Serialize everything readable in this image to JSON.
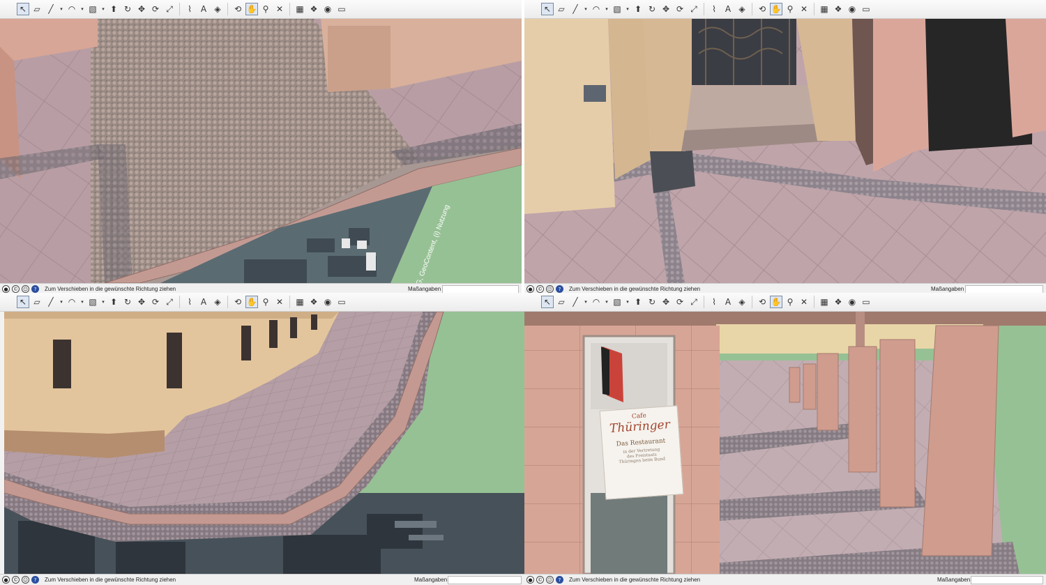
{
  "toolbar": {
    "icons": [
      "select-icon",
      "eraser-icon",
      "line-icon",
      "arc-icon",
      "shape-icon",
      "push-pull-icon",
      "follow-me-icon",
      "move-icon",
      "rotate-icon",
      "scale-icon",
      "tape-measure-icon",
      "text-icon",
      "paint-bucket-icon",
      "orbit-icon",
      "pan-icon",
      "zoom-icon",
      "zoom-extents-icon",
      "3d-warehouse-icon",
      "components-icon",
      "extension-icon",
      "layout-icon"
    ],
    "glyphs": {
      "select": "↖",
      "eraser": "▱",
      "line": "╱",
      "arc": "◠",
      "shape": "▧",
      "push_pull": "⬆",
      "follow_me": "↻",
      "move": "✥",
      "rotate": "⟳",
      "scale": "⤢",
      "tape": "⌇",
      "text": "A",
      "paint": "◈",
      "orbit": "⟲",
      "pan": "✋",
      "zoom": "⚲",
      "zoom_extents": "✕",
      "warehouse": "▦",
      "components": "❖",
      "extension": "◉",
      "layout": "▭",
      "dropdown": "▾"
    }
  },
  "status": {
    "hint": "Zum Verschieben in die gewünschte Richtung ziehen",
    "measurements_label": "Maßangaben",
    "measurements_value": ""
  },
  "panes": [
    {
      "id": "top-left",
      "scene": "paved-sidewalk-cobblestone-curb-aerial",
      "overlay_text": "BKG, GeoContent, (i) Nutzung"
    },
    {
      "id": "top-right",
      "scene": "building-entrance-gate-stone-paving",
      "overlay_text": ""
    },
    {
      "id": "bottom-left",
      "scene": "building-corner-wide-sidewalk-curb-aerial",
      "overlay_text": ""
    },
    {
      "id": "bottom-right",
      "scene": "arcade-pillars-restaurant-sign",
      "overlay_text": ""
    }
  ],
  "sign": {
    "line1": "Cafe",
    "line2": "Thüringer",
    "line3": "Das Restaurant",
    "line4": "in der Vertretung",
    "line5": "des Freistaats",
    "line6": "Thüringen beim Bund"
  },
  "colors": {
    "sky_green": "#96c194",
    "paving": "#b59ea0",
    "cobble": "#8a7f86",
    "curb": "#c89a90",
    "facade_pink": "#d8a494",
    "facade_cream": "#e3c59d"
  }
}
